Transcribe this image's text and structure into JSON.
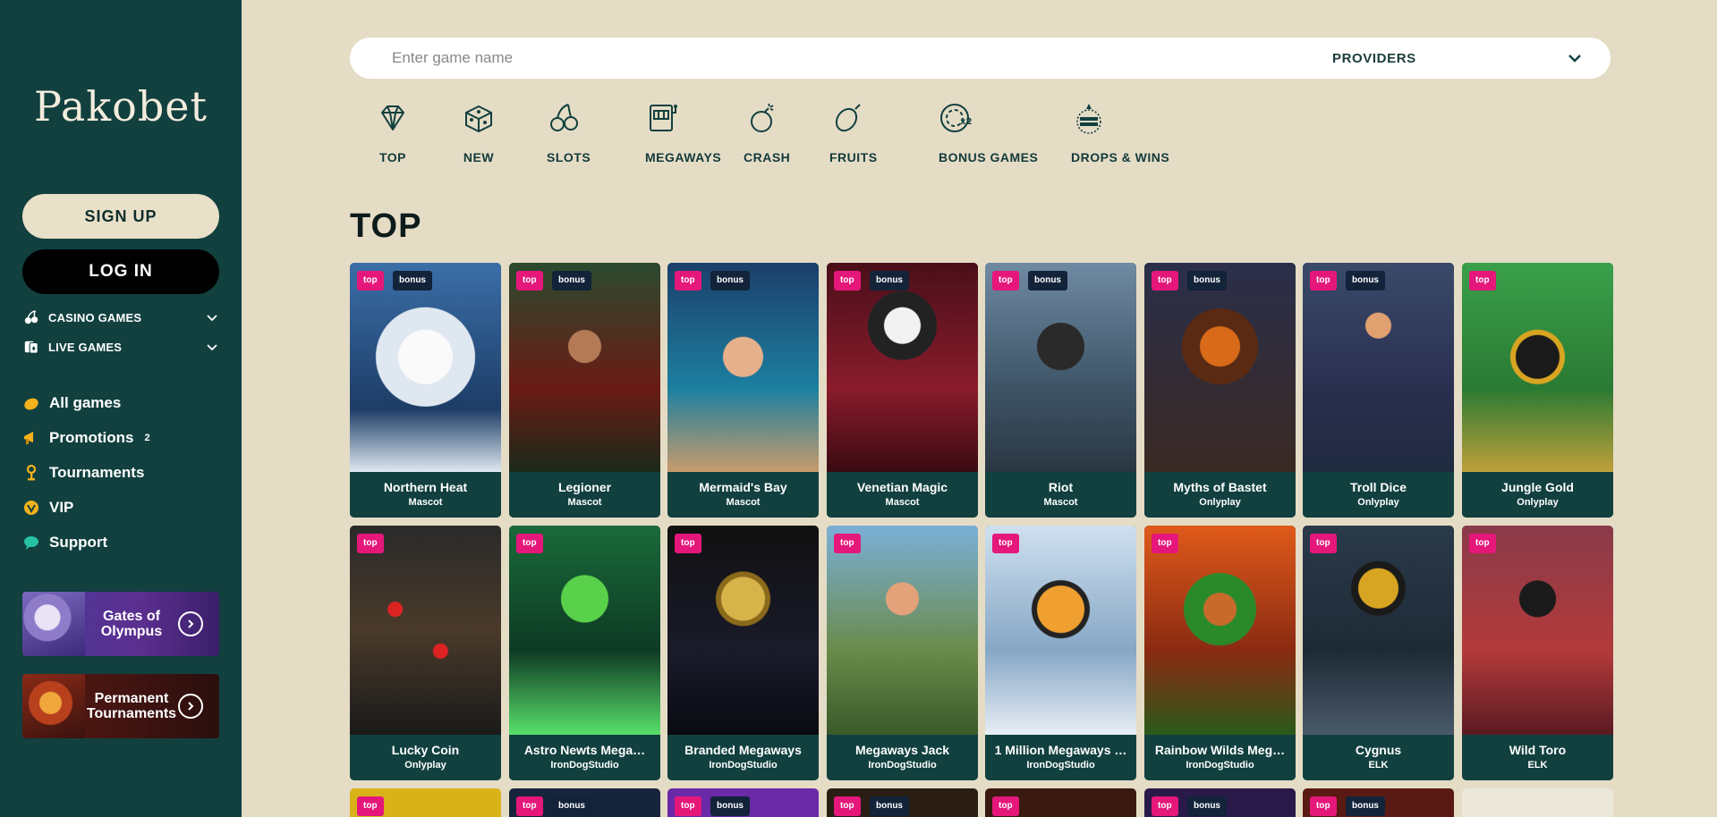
{
  "brand": {
    "name": "Pakobet"
  },
  "auth": {
    "signup": "SIGN UP",
    "login": "LOG IN"
  },
  "sidebar": {
    "categories": [
      {
        "label": "CASINO GAMES",
        "icon": "cherries-icon"
      },
      {
        "label": "LIVE GAMES",
        "icon": "cards-icon"
      }
    ],
    "nav": [
      {
        "label": "All games",
        "icon": "lemon-icon"
      },
      {
        "label": "Promotions",
        "icon": "megaphone-icon",
        "count": "2"
      },
      {
        "label": "Tournaments",
        "icon": "trophy-icon"
      },
      {
        "label": "VIP",
        "icon": "vip-icon"
      },
      {
        "label": "Support",
        "icon": "chat-icon"
      }
    ],
    "promos": [
      {
        "label": "Gates of Olympus"
      },
      {
        "label": "Permanent Tournaments"
      }
    ]
  },
  "search": {
    "placeholder": "Enter game name",
    "providers": "PROVIDERS"
  },
  "categories": [
    {
      "label": "TOP",
      "icon": "diamond-icon"
    },
    {
      "label": "NEW",
      "icon": "dice-icon"
    },
    {
      "label": "SLOTS",
      "icon": "cherry-icon"
    },
    {
      "label": "MEGAWAYS",
      "icon": "slot-machine-icon"
    },
    {
      "label": "CRASH",
      "icon": "bomb-icon"
    },
    {
      "label": "FRUITS",
      "icon": "lemon-icon"
    },
    {
      "label": "BONUS GAMES",
      "icon": "bonus-chip-icon"
    },
    {
      "label": "DROPS & WINS",
      "icon": "drops-wins-icon"
    }
  ],
  "section": {
    "title": "TOP"
  },
  "tags": {
    "top": "top",
    "bonus": "bonus"
  },
  "games": [
    {
      "name": "Northern Heat",
      "provider": "Mascot",
      "bonus": true
    },
    {
      "name": "Legioner",
      "provider": "Mascot",
      "bonus": true
    },
    {
      "name": "Mermaid's Bay",
      "provider": "Mascot",
      "bonus": true
    },
    {
      "name": "Venetian Magic",
      "provider": "Mascot",
      "bonus": true
    },
    {
      "name": "Riot",
      "provider": "Mascot",
      "bonus": true
    },
    {
      "name": "Myths of Bastet",
      "provider": "Onlyplay",
      "bonus": true
    },
    {
      "name": "Troll Dice",
      "provider": "Onlyplay",
      "bonus": true
    },
    {
      "name": "Jungle Gold",
      "provider": "Onlyplay",
      "bonus": false
    },
    {
      "name": "Lucky Coin",
      "provider": "Onlyplay",
      "bonus": false
    },
    {
      "name": "Astro Newts Mega…",
      "provider": "IronDogStudio",
      "bonus": false
    },
    {
      "name": "Branded Megaways",
      "provider": "IronDogStudio",
      "bonus": false
    },
    {
      "name": "Megaways Jack",
      "provider": "IronDogStudio",
      "bonus": false
    },
    {
      "name": "1 Million Megaways …",
      "provider": "IronDogStudio",
      "bonus": false
    },
    {
      "name": "Rainbow Wilds Meg…",
      "provider": "IronDogStudio",
      "bonus": false
    },
    {
      "name": "Cygnus",
      "provider": "ELK",
      "bonus": false
    },
    {
      "name": "Wild Toro",
      "provider": "ELK",
      "bonus": false
    }
  ],
  "partial_row": [
    {
      "top": true,
      "bonus": false
    },
    {
      "top": true,
      "bonus": true
    },
    {
      "top": true,
      "bonus": true
    },
    {
      "top": true,
      "bonus": true
    },
    {
      "top": true,
      "bonus": false
    },
    {
      "top": true,
      "bonus": true
    },
    {
      "top": true,
      "bonus": true
    },
    {
      "top": false,
      "bonus": false
    }
  ],
  "colors": {
    "sidebar": "#11403f",
    "background": "#e5dcc6",
    "tag_top": "#e5177a",
    "tag_bonus": "#12233a"
  }
}
